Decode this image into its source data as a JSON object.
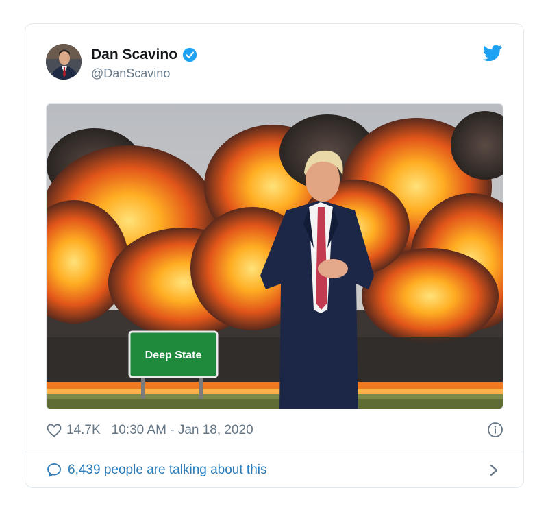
{
  "tweet": {
    "author_name": "Dan Scavino",
    "handle": "@DanScavino",
    "verified": true,
    "media_alt": "Deep State",
    "sign_text": "Deep State",
    "likes": "14.7K",
    "timestamp": "10:30 AM - Jan 18, 2020",
    "talking": "6,439 people are talking about this"
  },
  "icons": {
    "verified": "verified-badge-icon",
    "twitter": "twitter-bird-icon",
    "like": "heart-icon",
    "info": "info-icon",
    "reply": "speech-bubble-icon",
    "chevron": "chevron-right-icon"
  },
  "colors": {
    "brand": "#1da1f2",
    "link": "#2b7bb9",
    "muted": "#657786",
    "sign_green": "#1f8a3c"
  }
}
